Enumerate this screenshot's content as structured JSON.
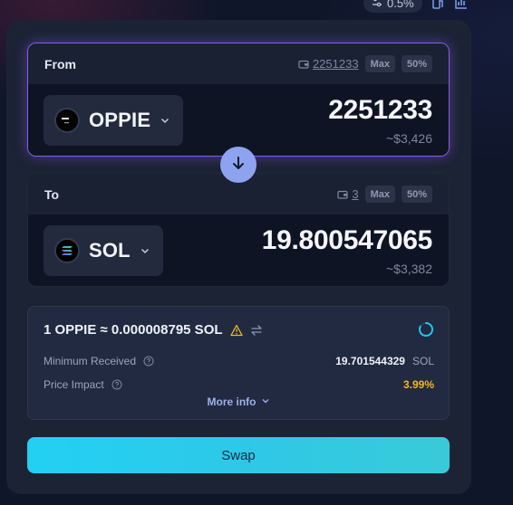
{
  "toolbar": {
    "slippage": "0.5%",
    "icons": [
      "sliders-icon",
      "bridge-icon",
      "chart-icon"
    ]
  },
  "from": {
    "label": "From",
    "balance": "2251233",
    "max_label": "Max",
    "half_label": "50%",
    "token_symbol": "OPPIE",
    "amount": "2251233",
    "usd": "~$3,426"
  },
  "to": {
    "label": "To",
    "balance": "3",
    "max_label": "Max",
    "half_label": "50%",
    "token_symbol": "SOL",
    "amount": "19.800547065",
    "usd": "~$3,382"
  },
  "info": {
    "rate": "1 OPPIE ≈ 0.000008795 SOL",
    "min_received_label": "Minimum Received",
    "min_received_value": "19.701544329",
    "min_received_unit": "SOL",
    "price_impact_label": "Price Impact",
    "price_impact_value": "3.99%",
    "more_info_label": "More info"
  },
  "swap_button": "Swap",
  "colors": {
    "accent_purple": "#8a5cf0",
    "swap_gradient_start": "#22d0f3",
    "swap_gradient_end": "#38cad8",
    "warning": "#f0b72c",
    "direction_button": "#8ea3ef"
  }
}
